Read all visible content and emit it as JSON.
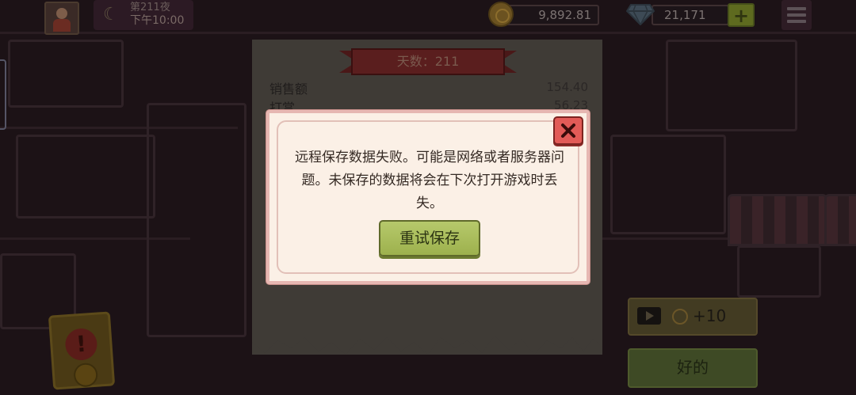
{
  "hud": {
    "night_label": "第211夜",
    "time_label": "下午10:00",
    "coins": "9,892.81",
    "gems": "21,171",
    "add_gems_label": "+",
    "icons": {
      "portrait": "character-portrait-icon",
      "moon": "moon-icon",
      "coin": "coin-icon",
      "gem": "diamond-icon",
      "menu": "hamburger-menu-icon"
    }
  },
  "summary": {
    "day_label": "天数：211",
    "rows": [
      {
        "label": "销售额",
        "value": "154.40"
      },
      {
        "label": "打赏",
        "value": "56.23"
      }
    ]
  },
  "dialog": {
    "message": "远程保存数据失败。可能是网络或者服务器问题。未保存的数据将会在下次打开游戏时丢失。",
    "retry_label": "重试保存",
    "colors": {
      "close": "#e25b57",
      "retry": "#a9bd5c",
      "panel": "#fbf0e6"
    }
  },
  "actions": {
    "ad_reward": "+10",
    "ok_label": "好的"
  }
}
